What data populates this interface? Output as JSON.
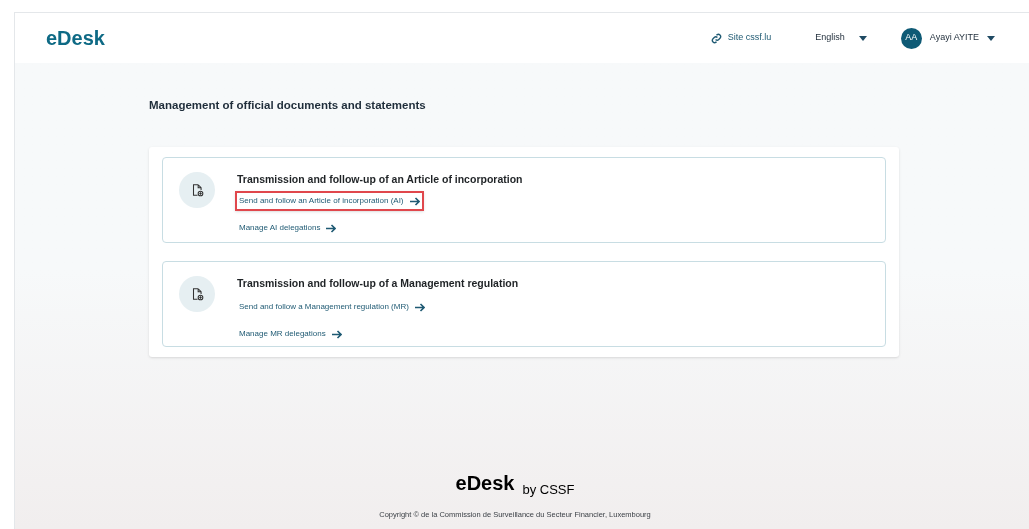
{
  "header": {
    "logo": "eDesk",
    "site_link": "Site cssf.lu",
    "language": "English",
    "user": {
      "initials": "AA",
      "name": "Ayayi AYITE"
    }
  },
  "page_title": "Management of official documents and statements",
  "sections": [
    {
      "title": "Transmission and follow-up of an Article of incorporation",
      "links": [
        {
          "label": "Send and follow an Article of incorporation (AI)",
          "highlighted": true
        },
        {
          "label": "Manage AI delegations",
          "highlighted": false
        }
      ]
    },
    {
      "title": "Transmission and follow-up of a Management regulation",
      "links": [
        {
          "label": "Send and follow a Management regulation (MR)",
          "highlighted": false
        },
        {
          "label": "Manage MR delegations",
          "highlighted": false
        }
      ]
    }
  ],
  "footer": {
    "logo": "eDesk",
    "by": "by CSSF",
    "copyright": "Copyright © de la Commission de Surveillance du Secteur Financier, Luxembourg"
  }
}
